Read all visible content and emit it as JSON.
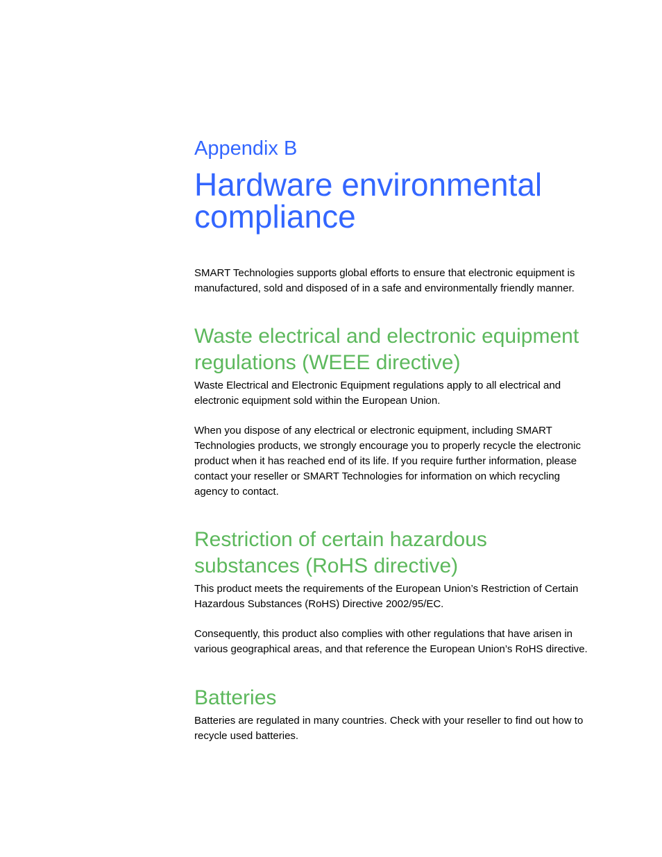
{
  "appendix_label": "Appendix B",
  "title_lines": [
    "Hardware environmental",
    "compliance"
  ],
  "intro_lines": [
    "SMART Technologies supports global efforts to ensure that electronic equipment is",
    "manufactured, sold and disposed of in a safe and environmentally friendly manner."
  ],
  "sections": [
    {
      "heading_lines": [
        "Waste electrical and electronic equipment",
        "regulations (WEEE directive)"
      ],
      "paragraphs": [
        [
          "Waste Electrical and Electronic Equipment regulations apply to all electrical and",
          "electronic equipment sold within the European Union."
        ],
        [
          "When you dispose of any electrical or electronic equipment, including SMART",
          "Technologies products, we strongly encourage you to properly recycle the electronic",
          "product when it has reached end of its life. If you require further information, please",
          "contact your reseller or SMART Technologies for information on which recycling",
          "agency to contact."
        ]
      ]
    },
    {
      "heading_lines": [
        "Restriction of certain hazardous",
        "substances (RoHS directive)"
      ],
      "paragraphs": [
        [
          "This product meets the requirements of the European Union’s Restriction of Certain",
          "Hazardous Substances (RoHS) Directive 2002/95/EC."
        ],
        [
          "Consequently, this product also complies with other regulations that have arisen in",
          "various geographical areas, and that reference the European Union’s RoHS directive."
        ]
      ]
    },
    {
      "heading_lines": [
        "Batteries"
      ],
      "paragraphs": [
        [
          "Batteries are regulated in many countries. Check with your reseller to find out how to",
          "recycle used batteries."
        ]
      ]
    }
  ]
}
